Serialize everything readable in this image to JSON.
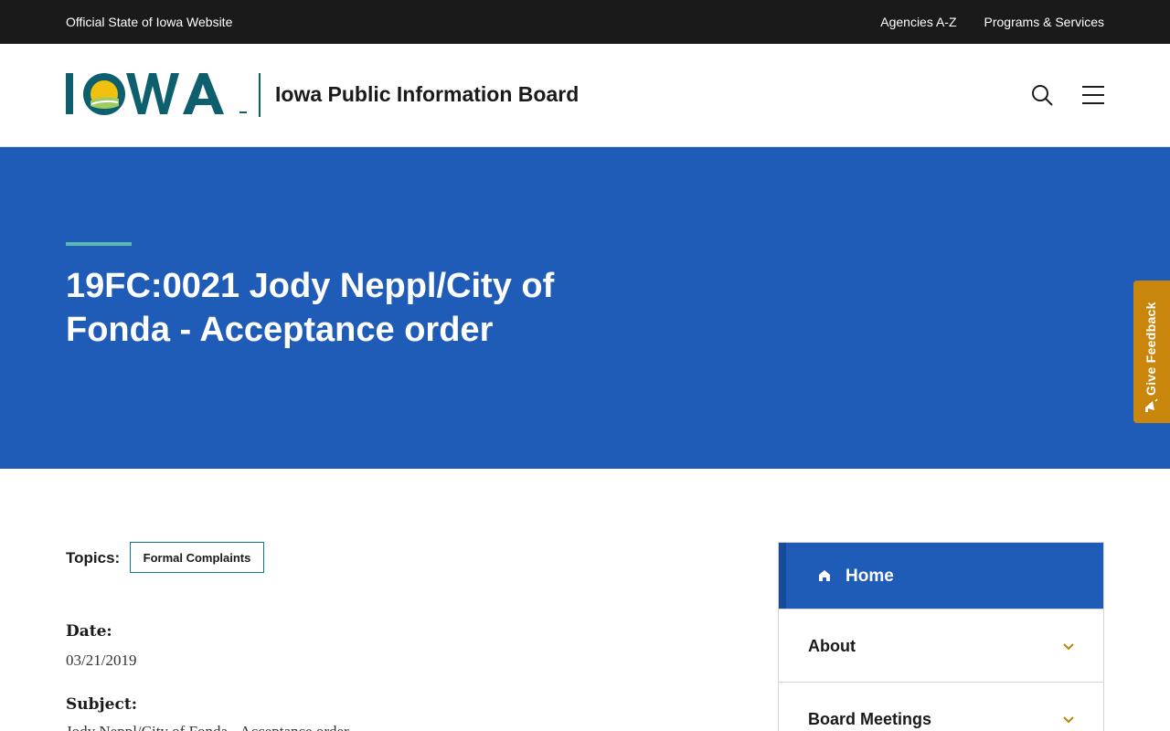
{
  "topbar": {
    "official_text": "Official State of Iowa Website",
    "links": [
      "Agencies A-Z",
      "Programs & Services"
    ]
  },
  "header": {
    "logo_text": "IOWA",
    "site_name": "Iowa Public Information Board",
    "icons": [
      "search-icon",
      "hamburger-menu-icon"
    ]
  },
  "hero": {
    "title": "19FC:0021 Jody Neppl/City of Fonda - Acceptance order"
  },
  "feedback": {
    "label": "Give Feedback",
    "icon": "megaphone-icon"
  },
  "content": {
    "topics_label": "Topics:",
    "topic_tag": "Formal Complaints",
    "date_label": "Date:",
    "date_value": "03/21/2019",
    "subject_label": "Subject:",
    "subject_value": "Jody Neppl/City of Fonda - Acceptance order"
  },
  "sidenav": {
    "home": "Home",
    "items": [
      "About",
      "Board Meetings"
    ]
  },
  "colors": {
    "hero_blue": "#1f5cb8",
    "accent_teal": "#5cb8b2",
    "feedback_gold": "#c8860d",
    "topbar_dark": "#1a1a1a",
    "chevron_gold": "#b8860b"
  }
}
